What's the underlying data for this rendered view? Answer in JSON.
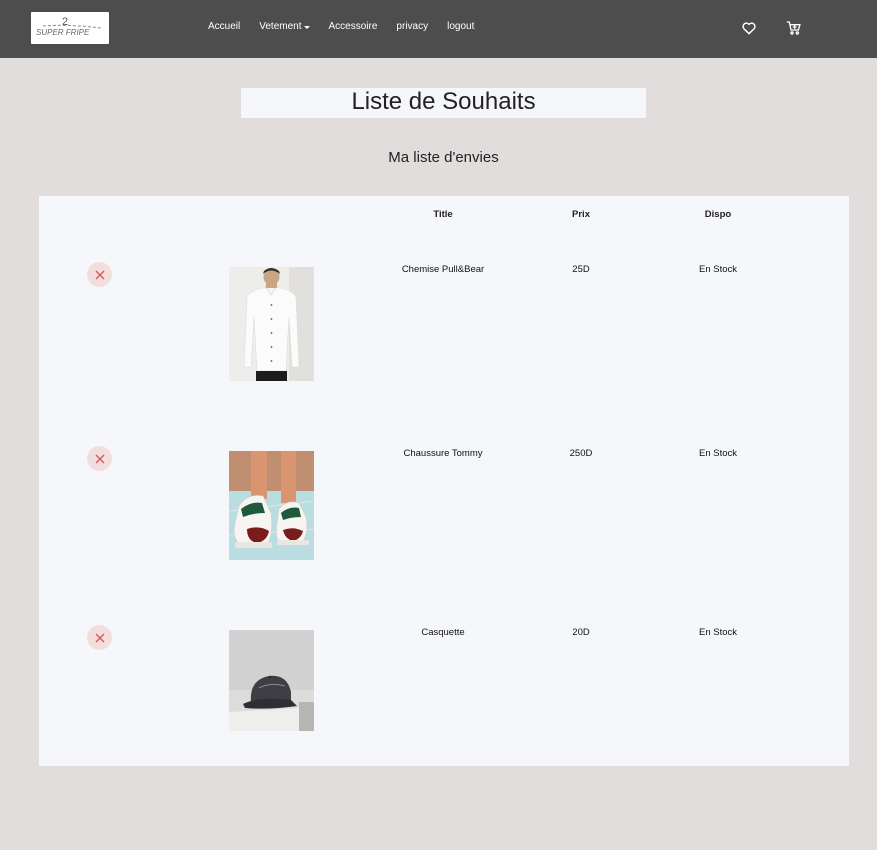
{
  "nav": {
    "logo_text": "SUPER FRIPE",
    "logo_number": "2",
    "links": [
      {
        "label": "Accueil"
      },
      {
        "label": "Vetement"
      },
      {
        "label": "Accessoire"
      },
      {
        "label": "privacy"
      },
      {
        "label": "logout"
      }
    ]
  },
  "page": {
    "title": "Liste de Souhaits",
    "subtitle": "Ma liste d'envies"
  },
  "table": {
    "headers": {
      "title": "Title",
      "price": "Prix",
      "dispo": "Dispo"
    },
    "rows": [
      {
        "title": "Chemise Pull&Bear",
        "price": "25D",
        "dispo": "En Stock"
      },
      {
        "title": "Chaussure Tommy",
        "price": "250D",
        "dispo": "En Stock"
      },
      {
        "title": "Casquette",
        "price": "20D",
        "dispo": "En Stock"
      }
    ]
  },
  "colors": {
    "navbar": "#4d4d4d",
    "background": "#e2dddd",
    "card": "#f5f7fa",
    "remove_bg": "#f3dede",
    "remove_icon": "#d9534f"
  },
  "icons": [
    "heart-icon",
    "cart-icon",
    "close-icon"
  ]
}
